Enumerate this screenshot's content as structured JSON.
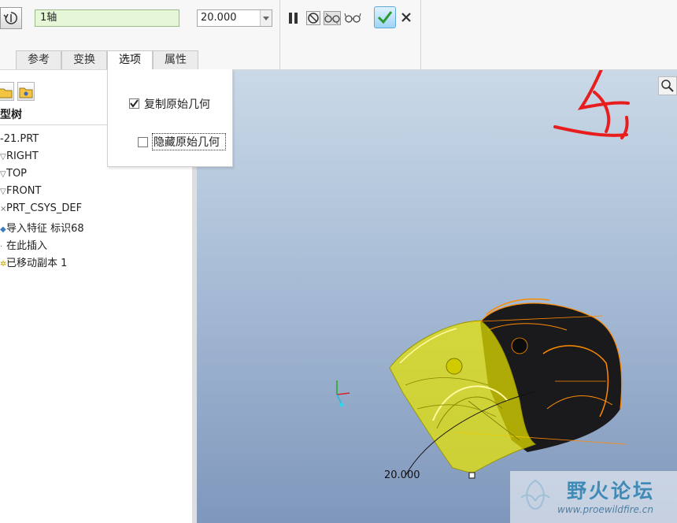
{
  "dashboard": {
    "axis_reference": "1轴",
    "value": "20.000",
    "tabs": [
      {
        "label": "参考"
      },
      {
        "label": "变换"
      },
      {
        "label": "选项"
      },
      {
        "label": "属性"
      }
    ],
    "active_tab": "选项"
  },
  "options": {
    "copy_original": {
      "label": "复制原始几何",
      "checked": true
    },
    "hide_original": {
      "label": "隐藏原始几何",
      "checked": false
    }
  },
  "model_tree": {
    "title": "型树",
    "items": [
      {
        "label": "-21.PRT",
        "marker": ""
      },
      {
        "label": "RIGHT",
        "marker": "▽"
      },
      {
        "label": "TOP",
        "marker": "▽"
      },
      {
        "label": "FRONT",
        "marker": "▽"
      },
      {
        "label": "PRT_CSYS_DEF",
        "marker": "×"
      },
      {
        "label": "导入特征 标识68",
        "marker": "◆"
      },
      {
        "label": "在此插入",
        "marker": "·"
      },
      {
        "label": "已移动副本 1",
        "marker": "✲"
      }
    ]
  },
  "viewport": {
    "dimension_value": "20.000",
    "handwriting": "4"
  },
  "watermark": {
    "title": "野火论坛",
    "url": "www.proewildfire.cn"
  },
  "colors": {
    "accent_ok": "#2d9c2d",
    "axis_input_bg": "#e6f7d8",
    "moved_copy_yellow": "#e7e300",
    "original_edge_orange": "#ff8a00"
  }
}
